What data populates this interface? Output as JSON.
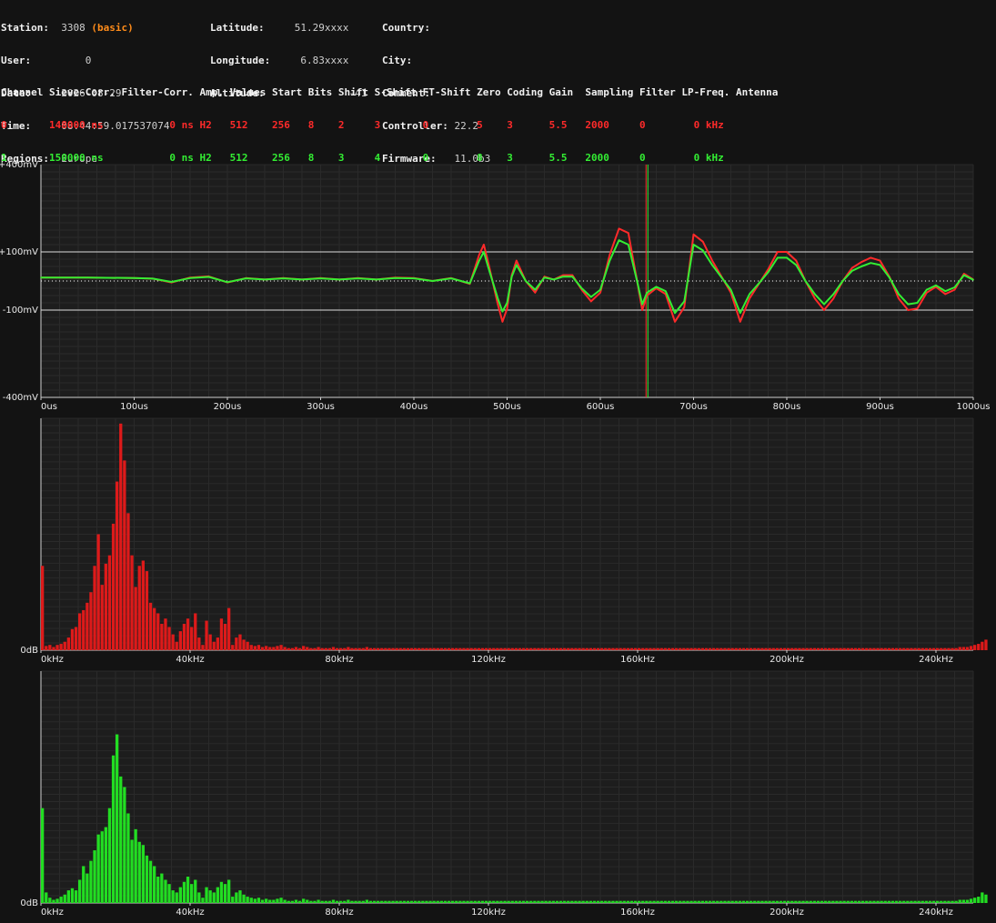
{
  "header": {
    "col1": [
      {
        "key": "Station:",
        "value": "3308",
        "extra": "(basic)"
      },
      {
        "key": "User:",
        "value": "0"
      },
      {
        "key": "Date:",
        "value": "2026-08-29"
      },
      {
        "key": "Time:",
        "value": "08:44:59.017537074"
      },
      {
        "key": "Regions:",
        "value": "Europe"
      }
    ],
    "col2": [
      {
        "key": "Latitude:",
        "value": "51.29xxxx"
      },
      {
        "key": "Longitude:",
        "value": "6.83xxxx"
      },
      {
        "key": "Altitude:",
        "value": "-41"
      }
    ],
    "col3": [
      {
        "key": "Country:",
        "value": ""
      },
      {
        "key": "City:",
        "value": ""
      },
      {
        "key": "Comment:",
        "value": ""
      },
      {
        "key": "Controller:",
        "value": "22.2"
      },
      {
        "key": "Firmware:",
        "value": "11.0b3"
      }
    ]
  },
  "channel_table": {
    "header_line": "Channel Sieve-Corr. Filter-Corr. Amp. Values Start Bits Shift S-Shift FT-Shift Zero Coding Gain  Sampling Filter LP-Freq. Antenna",
    "rows": [
      {
        "line": "0       148000 ns           0 ns H2   512    256   8    2     3       0        5    3      5.5   2000     0        0 kHz",
        "color": "#ff2a2a"
      },
      {
        "line": "1       150000 ns           0 ns H2   512    256   8    3     4       0        8    3      5.5   2000     0        0 kHz",
        "color": "#33ee33"
      }
    ]
  },
  "colors": {
    "background": "#131313",
    "plot_bg": "#1d1d1d",
    "grid": "#3a3a3a",
    "grid_minor": "#2a2a2a",
    "channel0": "#ff2a2a",
    "channel0_bar": "#dd1a1a",
    "channel1": "#33ee33",
    "channel1_bar": "#22dd22",
    "orange": "#ff8c1a"
  },
  "chart_data": [
    {
      "type": "line",
      "x_unit": "us",
      "xlim": [
        0,
        1000
      ],
      "ylim": [
        -400,
        400
      ],
      "x_tick_labels": [
        "0us",
        "100us",
        "200us",
        "300us",
        "400us",
        "500us",
        "600us",
        "700us",
        "800us",
        "900us",
        "1000us"
      ],
      "y_tick_labels": [
        "+400mV",
        "+100mV",
        "-100mV",
        "-400mV"
      ],
      "y_tick_values": [
        400,
        100,
        -100,
        -400
      ],
      "marker_line_x": 650,
      "series": [
        {
          "channel": "0",
          "color": "#ff2a2a",
          "x": [
            0,
            50,
            100,
            120,
            140,
            160,
            180,
            200,
            220,
            240,
            260,
            280,
            300,
            320,
            340,
            360,
            380,
            400,
            420,
            440,
            460,
            470,
            475,
            480,
            490,
            495,
            500,
            505,
            510,
            520,
            530,
            540,
            550,
            560,
            570,
            580,
            590,
            600,
            610,
            620,
            630,
            640,
            645,
            650,
            660,
            670,
            680,
            690,
            700,
            710,
            720,
            730,
            740,
            750,
            760,
            770,
            780,
            790,
            800,
            810,
            820,
            830,
            840,
            850,
            860,
            870,
            880,
            890,
            900,
            910,
            920,
            930,
            940,
            950,
            960,
            970,
            980,
            990,
            1000
          ],
          "y": [
            12,
            12,
            10,
            8,
            -5,
            12,
            16,
            -5,
            10,
            5,
            10,
            5,
            10,
            5,
            10,
            5,
            12,
            10,
            0,
            10,
            -10,
            90,
            125,
            60,
            -80,
            -140,
            -95,
            20,
            70,
            0,
            -40,
            15,
            5,
            20,
            20,
            -30,
            -70,
            -40,
            90,
            180,
            165,
            -10,
            -100,
            -50,
            -25,
            -45,
            -140,
            -90,
            160,
            135,
            70,
            15,
            -40,
            -140,
            -60,
            -10,
            40,
            100,
            100,
            70,
            0,
            -60,
            -100,
            -60,
            0,
            45,
            65,
            80,
            70,
            15,
            -60,
            -100,
            -95,
            -40,
            -20,
            -45,
            -30,
            25,
            5
          ]
        },
        {
          "channel": "1",
          "color": "#33ee33",
          "x": [
            0,
            50,
            100,
            120,
            140,
            160,
            180,
            200,
            220,
            240,
            260,
            280,
            300,
            320,
            340,
            360,
            380,
            400,
            420,
            440,
            460,
            470,
            475,
            480,
            490,
            495,
            500,
            505,
            510,
            520,
            530,
            540,
            550,
            560,
            570,
            580,
            590,
            600,
            610,
            620,
            630,
            640,
            645,
            650,
            660,
            670,
            680,
            690,
            700,
            710,
            720,
            730,
            740,
            750,
            760,
            770,
            780,
            790,
            800,
            810,
            820,
            830,
            840,
            850,
            860,
            870,
            880,
            890,
            900,
            910,
            920,
            930,
            940,
            950,
            960,
            970,
            980,
            990,
            1000
          ],
          "y": [
            12,
            12,
            10,
            8,
            -3,
            10,
            14,
            -4,
            9,
            5,
            9,
            5,
            9,
            5,
            9,
            5,
            10,
            9,
            0,
            9,
            -8,
            70,
            100,
            45,
            -60,
            -105,
            -75,
            15,
            55,
            0,
            -30,
            12,
            5,
            15,
            15,
            -25,
            -55,
            -30,
            70,
            140,
            125,
            -8,
            -80,
            -40,
            -20,
            -35,
            -110,
            -70,
            125,
            105,
            55,
            12,
            -30,
            -110,
            -45,
            -8,
            30,
            80,
            80,
            55,
            0,
            -45,
            -80,
            -45,
            0,
            35,
            50,
            62,
            55,
            12,
            -45,
            -80,
            -75,
            -30,
            -15,
            -35,
            -22,
            20,
            4
          ]
        }
      ]
    },
    {
      "type": "bar",
      "channel": "0",
      "color": "#dd1a1a",
      "x_unit": "kHz",
      "xlim": [
        0,
        250
      ],
      "x_tick_labels": [
        "0kHz",
        "40kHz",
        "80kHz",
        "120kHz",
        "160kHz",
        "200kHz",
        "240kHz"
      ],
      "y_tick_labels": [
        "0dB"
      ],
      "ylim": [
        0,
        220
      ],
      "bin_width_khz": 1,
      "values": [
        80,
        4,
        5,
        3,
        5,
        6,
        8,
        12,
        20,
        22,
        35,
        38,
        45,
        55,
        80,
        110,
        62,
        82,
        90,
        120,
        160,
        215,
        180,
        130,
        90,
        60,
        80,
        85,
        75,
        45,
        40,
        35,
        25,
        30,
        22,
        15,
        8,
        18,
        25,
        30,
        22,
        35,
        12,
        5,
        28,
        15,
        8,
        12,
        30,
        25,
        40,
        5,
        12,
        15,
        10,
        8,
        5,
        4,
        5,
        3,
        4,
        3,
        3,
        4,
        5,
        3,
        2,
        2,
        3,
        2,
        4,
        3,
        2,
        2,
        3,
        2,
        2,
        2,
        3,
        2,
        2,
        2,
        3,
        2,
        2,
        2,
        2,
        3,
        2,
        2,
        2,
        2,
        2,
        2,
        2,
        2,
        2,
        2,
        2,
        2,
        2,
        2,
        2,
        2,
        2,
        2,
        2,
        2,
        2,
        2,
        2,
        2,
        2,
        2,
        2,
        2,
        2,
        2,
        2,
        2,
        2,
        2,
        2,
        2,
        2,
        2,
        2,
        2,
        2,
        2,
        2,
        2,
        2,
        2,
        2,
        2,
        2,
        2,
        2,
        2,
        2,
        2,
        2,
        2,
        2,
        2,
        2,
        2,
        2,
        2,
        2,
        2,
        2,
        2,
        2,
        2,
        2,
        2,
        2,
        2,
        2,
        2,
        2,
        2,
        2,
        2,
        2,
        2,
        2,
        2,
        2,
        2,
        2,
        2,
        2,
        2,
        2,
        2,
        2,
        2,
        2,
        2,
        2,
        2,
        2,
        2,
        2,
        2,
        2,
        2,
        2,
        2,
        2,
        2,
        2,
        2,
        2,
        2,
        2,
        2,
        2,
        2,
        2,
        2,
        2,
        2,
        2,
        2,
        2,
        2,
        2,
        2,
        2,
        2,
        2,
        2,
        2,
        2,
        2,
        2,
        2,
        2,
        2,
        2,
        2,
        2,
        2,
        2,
        2,
        2,
        2,
        2,
        2,
        2,
        2,
        2,
        2,
        2,
        2,
        2,
        2,
        2,
        2,
        2,
        2,
        2,
        3,
        3,
        3,
        4,
        5,
        6,
        8,
        10
      ]
    },
    {
      "type": "bar",
      "channel": "1",
      "color": "#22dd22",
      "x_unit": "kHz",
      "xlim": [
        0,
        250
      ],
      "x_tick_labels": [
        "0kHz",
        "40kHz",
        "80kHz",
        "120kHz",
        "160kHz",
        "200kHz",
        "240kHz"
      ],
      "y_tick_labels": [
        "0dB"
      ],
      "ylim": [
        0,
        220
      ],
      "bin_width_khz": 1,
      "values": [
        90,
        10,
        5,
        3,
        4,
        6,
        8,
        12,
        14,
        12,
        22,
        35,
        28,
        40,
        50,
        65,
        68,
        72,
        90,
        140,
        160,
        120,
        110,
        85,
        60,
        70,
        58,
        55,
        45,
        40,
        35,
        25,
        28,
        22,
        18,
        12,
        10,
        15,
        20,
        25,
        18,
        22,
        10,
        5,
        15,
        12,
        10,
        15,
        20,
        18,
        22,
        6,
        10,
        12,
        8,
        6,
        5,
        4,
        5,
        3,
        4,
        3,
        3,
        4,
        5,
        3,
        2,
        2,
        3,
        2,
        4,
        3,
        2,
        2,
        3,
        2,
        2,
        2,
        3,
        2,
        2,
        2,
        3,
        2,
        2,
        2,
        2,
        3,
        2,
        2,
        2,
        2,
        2,
        2,
        2,
        2,
        2,
        2,
        2,
        2,
        2,
        2,
        2,
        2,
        2,
        2,
        2,
        2,
        2,
        2,
        2,
        2,
        2,
        2,
        2,
        2,
        2,
        2,
        2,
        2,
        2,
        2,
        2,
        2,
        2,
        2,
        2,
        2,
        2,
        2,
        2,
        2,
        2,
        2,
        2,
        2,
        2,
        2,
        2,
        2,
        2,
        2,
        2,
        2,
        2,
        2,
        2,
        2,
        2,
        2,
        2,
        2,
        2,
        2,
        2,
        2,
        2,
        2,
        2,
        2,
        2,
        2,
        2,
        2,
        2,
        2,
        2,
        2,
        2,
        2,
        2,
        2,
        2,
        2,
        2,
        2,
        2,
        2,
        2,
        2,
        2,
        2,
        2,
        2,
        2,
        2,
        2,
        2,
        2,
        2,
        2,
        2,
        2,
        2,
        2,
        2,
        2,
        2,
        2,
        2,
        2,
        2,
        2,
        2,
        2,
        2,
        2,
        2,
        2,
        2,
        2,
        2,
        2,
        2,
        2,
        2,
        2,
        2,
        2,
        2,
        2,
        2,
        2,
        2,
        2,
        2,
        2,
        2,
        2,
        2,
        2,
        2,
        2,
        2,
        2,
        2,
        2,
        2,
        2,
        2,
        2,
        2,
        2,
        2,
        2,
        2,
        3,
        3,
        3,
        4,
        5,
        6,
        10,
        8
      ]
    }
  ]
}
